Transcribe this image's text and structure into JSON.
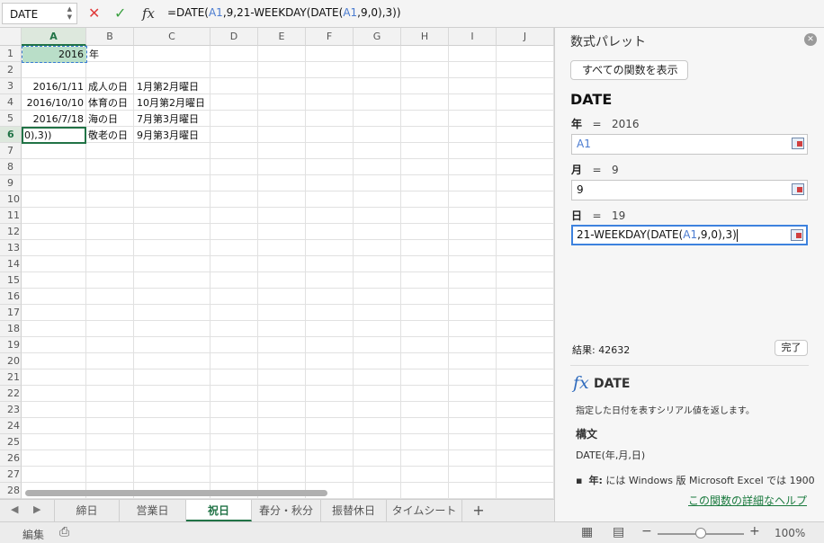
{
  "formula_bar": {
    "name_box": "DATE",
    "fx": "fx",
    "formula_parts": [
      "=DATE(",
      "A1",
      ",9,21-WEEKDAY(DATE(",
      "A1",
      ",9,0),3))"
    ]
  },
  "grid": {
    "columns": [
      "A",
      "B",
      "C",
      "D",
      "E",
      "F",
      "G",
      "H",
      "I",
      "J"
    ],
    "rows": [
      "1",
      "2",
      "3",
      "4",
      "5",
      "6",
      "7",
      "8",
      "9",
      "10",
      "11",
      "12",
      "13",
      "14",
      "15",
      "16",
      "17",
      "18",
      "19",
      "20",
      "21",
      "22",
      "23",
      "24",
      "25",
      "26",
      "27",
      "28"
    ],
    "cells": {
      "a1": "2016",
      "b1": "年",
      "a3": "2016/1/11",
      "b3": "成人の日",
      "c3": "1月第2月曜日",
      "a4": "2016/10/10",
      "b4": "体育の日",
      "c4": "10月第2月曜日",
      "a5": "2016/7/18",
      "b5": "海の日",
      "c5": "7月第3月曜日",
      "a6": "0),3))",
      "b6": "敬老の日",
      "c6": "9月第3月曜日"
    }
  },
  "sheet_tabs": [
    "締日",
    "営業日",
    "祝日",
    "春分・秋分",
    "振替休日",
    "タイムシート"
  ],
  "active_tab": "祝日",
  "add_sheet": "+",
  "status": {
    "mode": "編集",
    "zoom": "100%",
    "zoom_minus": "−",
    "zoom_plus": "+"
  },
  "panel": {
    "title": "数式パレット",
    "show_all_button": "すべての関数を表示",
    "function_name": "DATE",
    "args": [
      {
        "label": "年",
        "eq": "=",
        "value": "2016",
        "field": "A1"
      },
      {
        "label": "月",
        "eq": "=",
        "value": "9",
        "field": "9"
      },
      {
        "label": "日",
        "eq": "=",
        "value": "19",
        "field_parts": [
          "21-WEEKDAY(DATE(",
          "A1",
          ",9,0),3)"
        ]
      }
    ],
    "result_label": "結果: 42632",
    "done_button": "完了",
    "help_func": "DATE",
    "help_fx": "fx",
    "description": "指定した日付を表すシリアル値を返します。",
    "syntax_heading": "構文",
    "syntax": "DATE(年,月,日)",
    "bullet_label": "年:",
    "bullet_text": "には Windows 版 Microsoft Excel では 1900",
    "help_link": "この関数の詳細なヘルプ"
  },
  "colors": {
    "accent": "#217346",
    "selection_fill": "#b9dec8",
    "ref_blue": "#4a7bd0",
    "link": "#1a7a3e"
  }
}
